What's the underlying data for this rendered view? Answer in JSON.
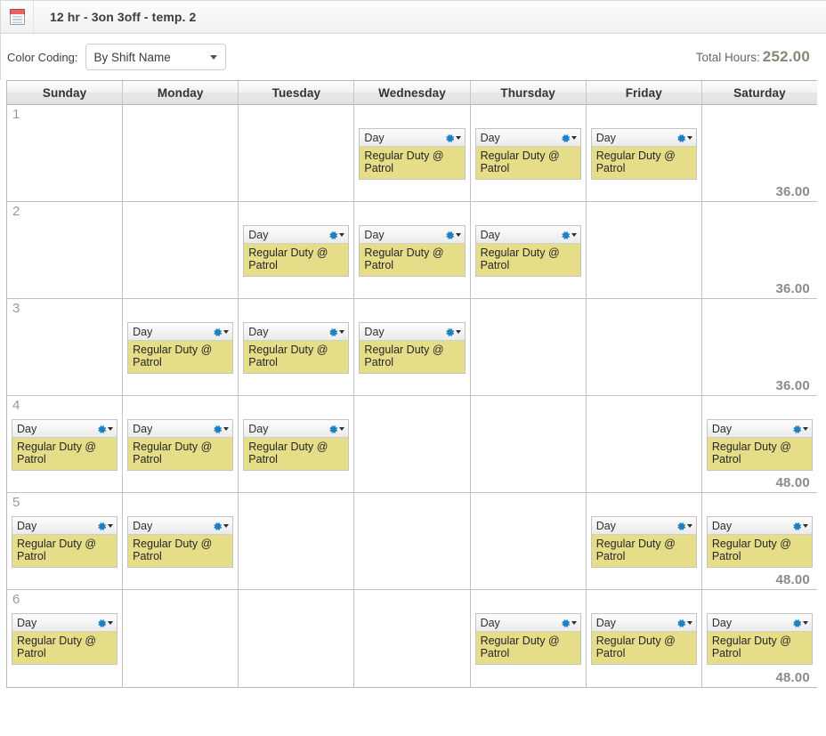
{
  "window": {
    "title": "12 hr - 3on 3off - temp. 2",
    "icon": "calendar-icon"
  },
  "toolbar": {
    "color_coding_label": "Color Coding:",
    "color_coding_value": "By Shift Name",
    "color_coding_options": [
      "By Shift Name"
    ],
    "total_hours_label": "Total Hours:",
    "total_hours_value": "252.00"
  },
  "calendar": {
    "day_headers": [
      "Sunday",
      "Monday",
      "Tuesday",
      "Wednesday",
      "Thursday",
      "Friday",
      "Saturday"
    ],
    "shift_label": "Day",
    "shift_detail": "Regular Duty @ Patrol",
    "shift_color": "#e5dd88",
    "rows": [
      {
        "number": "1",
        "total": "36.00",
        "days": [
          false,
          false,
          false,
          true,
          true,
          true,
          false
        ]
      },
      {
        "number": "2",
        "total": "36.00",
        "days": [
          false,
          false,
          true,
          true,
          true,
          false,
          false
        ]
      },
      {
        "number": "3",
        "total": "36.00",
        "days": [
          false,
          true,
          true,
          true,
          false,
          false,
          false
        ]
      },
      {
        "number": "4",
        "total": "48.00",
        "days": [
          true,
          true,
          true,
          false,
          false,
          false,
          true
        ]
      },
      {
        "number": "5",
        "total": "48.00",
        "days": [
          true,
          true,
          false,
          false,
          false,
          true,
          true
        ]
      },
      {
        "number": "6",
        "total": "48.00",
        "days": [
          true,
          false,
          false,
          false,
          true,
          true,
          true
        ]
      }
    ]
  }
}
